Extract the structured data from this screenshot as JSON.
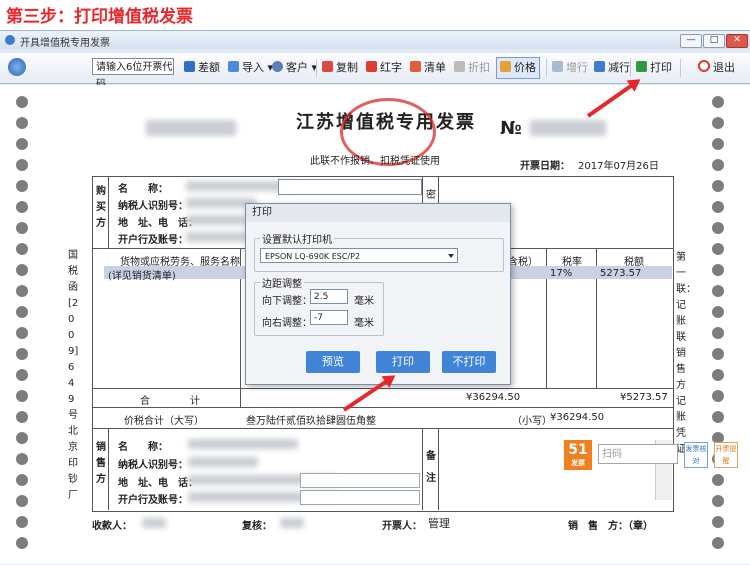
{
  "step_caption": "第三步：打印增值税发票",
  "window": {
    "title": "开具增值税专用发票",
    "min": "—",
    "max": "□",
    "close": "✕"
  },
  "toolbar": {
    "code_placeholder": "请输入6位开票代码",
    "diff": "差额",
    "import": "导入",
    "customer": "客户",
    "copy": "复制",
    "red": "红字",
    "list": "清单",
    "discount": "折扣",
    "price": "价格",
    "add_row": "增行",
    "del_row": "减行",
    "print": "打印",
    "exit": "退出"
  },
  "invoice": {
    "title": "江苏增值税专用发票",
    "no_label": "№",
    "subtitle": "此联不作报销、扣税凭证使用",
    "date_label": "开票日期：",
    "date_value": "2017年07月26日",
    "buyer_label": "购买方",
    "seller_label": "销售方",
    "name_label": "名　　称：",
    "taxid_label": "纳税人识别号：",
    "addr_label": "地　址、电　话：",
    "bank_label": "开户行及账号：",
    "pw_label": "密",
    "col_goods": "货物或应税劳务、服务名称",
    "col_tax_incl": "含税）",
    "col_rate": "税率",
    "col_tax": "税额",
    "row1_name": "(详见销货清单)",
    "row1_rate": "17%",
    "row1_tax": "5273.57",
    "total_label": "合　　　　计",
    "total_amount": "¥36294.50",
    "total_tax": "¥5273.57",
    "total_words_label": "价税合计（大写）",
    "total_words": "叁万陆仟贰佰玖拾肆圆伍角整",
    "small_label": "（小写）",
    "small_value": "¥36294.50",
    "remark_label": "备注",
    "receiver_label": "收款人：",
    "reviewer_label": "复核：",
    "issuer_label": "开票人：",
    "issuer_value": "管理",
    "seller_sign_label": "销　售　方：（章）",
    "left_code": "国税函[2009]649号北京印钞厂",
    "right_note": "第一联：记账联　销售方记账凭证"
  },
  "dialog": {
    "title": "打印",
    "group_printer": "设置默认打印机",
    "printer_value": "EPSON LQ-690K ESC/P2",
    "group_margin": "边距调整",
    "down_label": "向下调整：",
    "down_value": "2.5",
    "right_label": "向右调整：",
    "right_value": "-7",
    "unit": "毫米",
    "preview": "预览",
    "print": "打印",
    "no_print": "不打印"
  },
  "scan_widget": {
    "badge": "51",
    "badge_sub": "发票",
    "placeholder": "扫码",
    "verify": "发票核对",
    "open": "开票提醒"
  }
}
